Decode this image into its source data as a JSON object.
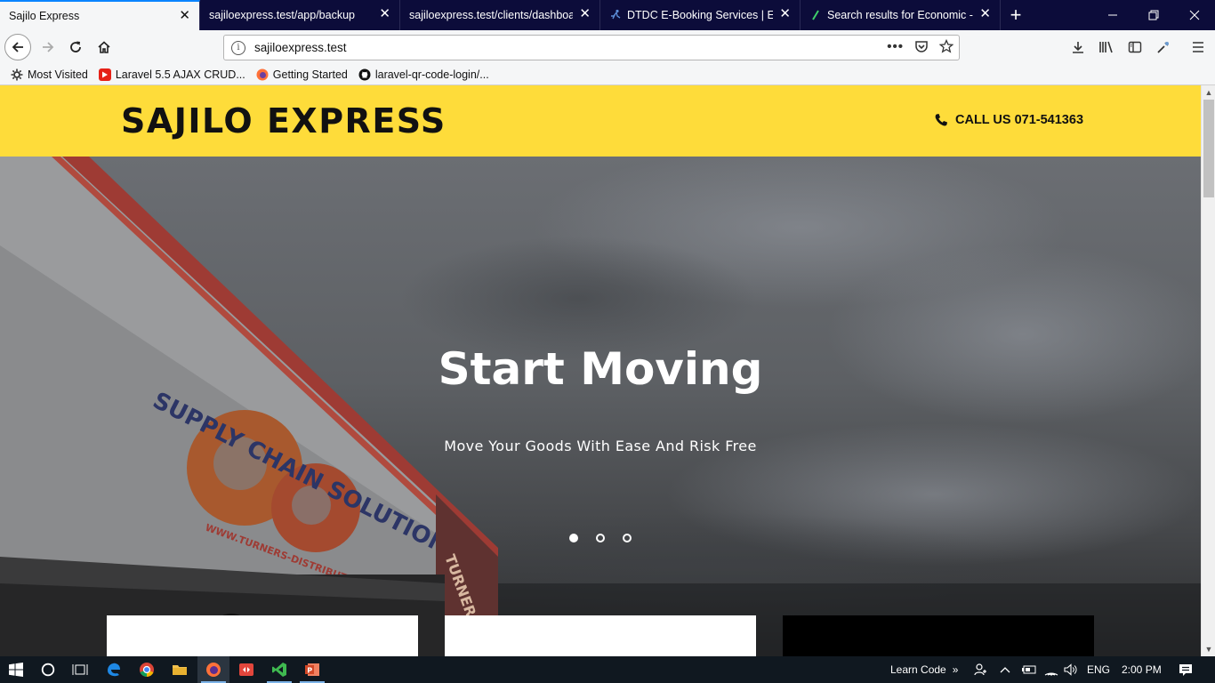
{
  "browser": {
    "tabs": [
      {
        "title": "Sajilo Express",
        "active": true,
        "favicon": "none"
      },
      {
        "title": "sajiloexpress.test/app/backup",
        "active": false,
        "favicon": "none"
      },
      {
        "title": "sajiloexpress.test/clients/dashboard",
        "active": false,
        "favicon": "none"
      },
      {
        "title": "DTDC E-Booking Services | Easi",
        "active": false,
        "favicon": "runner-icon"
      },
      {
        "title": "Search results for Economic - F",
        "active": false,
        "favicon": "leaf-icon"
      }
    ],
    "new_tab": "+",
    "url": "sajiloexpress.test",
    "bookmarks": [
      {
        "label": "Most Visited",
        "icon": "gear-icon"
      },
      {
        "label": "Laravel 5.5 AJAX CRUD...",
        "icon": "youtube-icon"
      },
      {
        "label": "Getting Started",
        "icon": "firefox-icon"
      },
      {
        "label": "laravel-qr-code-login/...",
        "icon": "github-icon"
      }
    ]
  },
  "site": {
    "brand": "SAJILO EXPRESS",
    "call_us": "CALL US 071-541363",
    "hero": {
      "title": "Start Moving",
      "subtitle": "Move Your Goods With Ease And Risk Free",
      "slide_count": 3,
      "active_slide": 1
    },
    "truck_text": {
      "line1": "SUPPLY CHAIN SOLUTIONS",
      "line2": "WWW.TURNERS-DISTRIBUTION.COM",
      "brand": "TURNERS"
    }
  },
  "taskbar": {
    "learn_code": "Learn Code",
    "language": "ENG",
    "time": "2:00 PM"
  },
  "colors": {
    "header_yellow": "#fedc3a",
    "tabstrip": "#0c0c3a",
    "taskbar": "#101820"
  }
}
